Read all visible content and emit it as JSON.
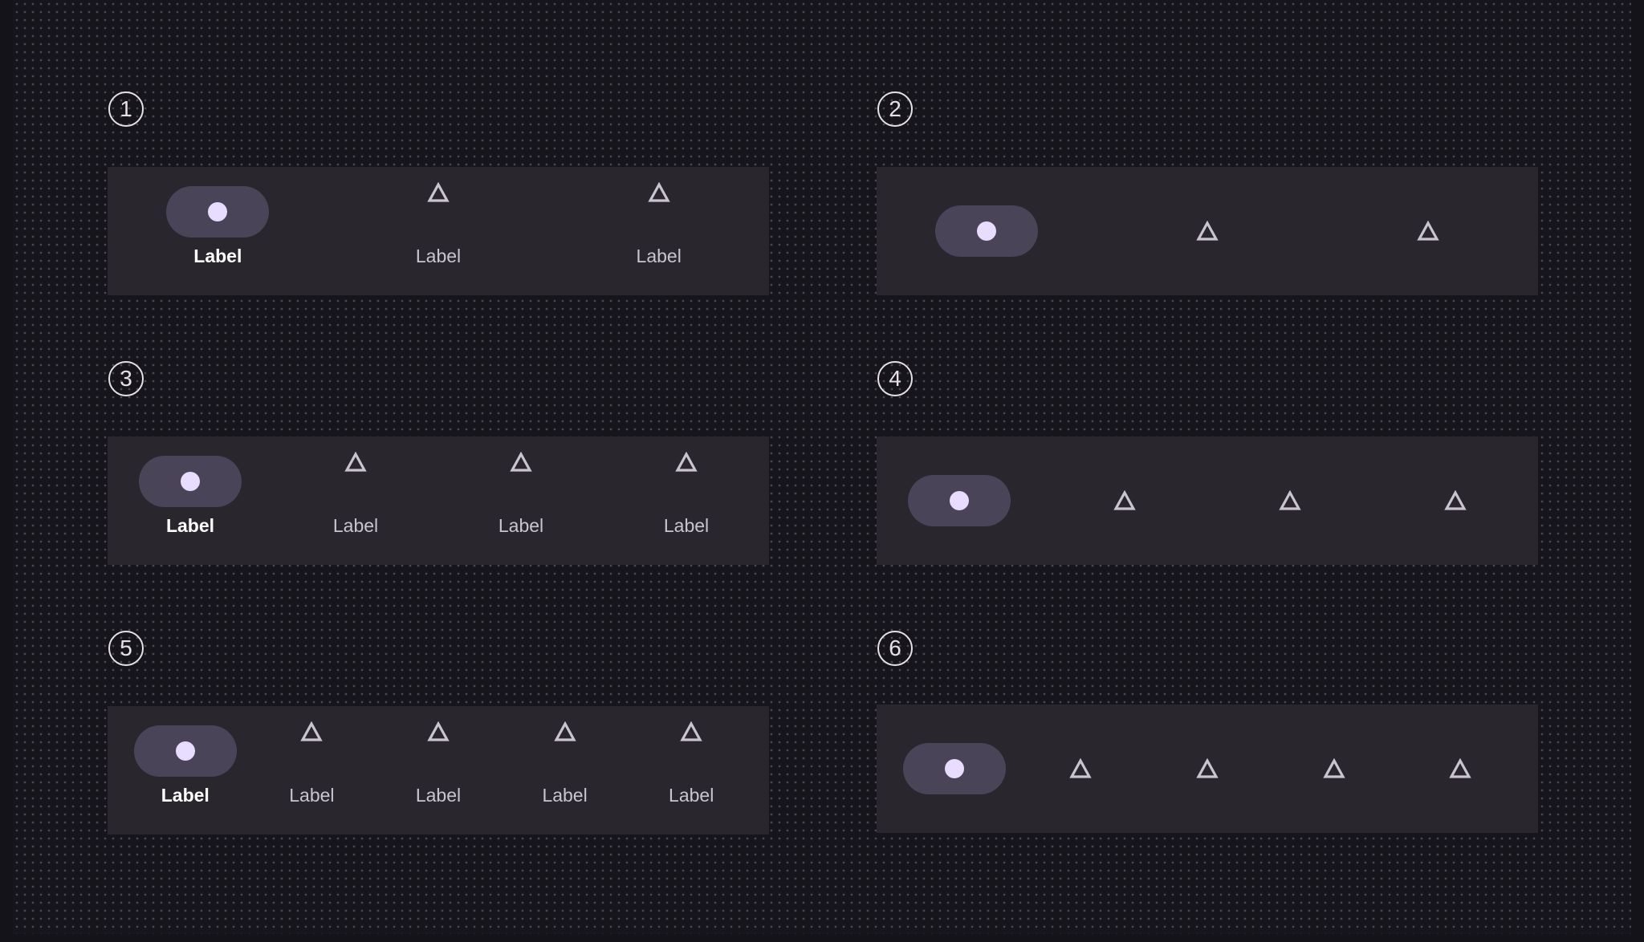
{
  "colors": {
    "background": "#15131a",
    "dot": "#4a4752",
    "bar": "#29272d",
    "indicator": "#4a4458",
    "active_dot": "#e8ddff",
    "icon": "#cac4d0",
    "badge": "#e6e1e5"
  },
  "variants": [
    {
      "number": "1",
      "items": [
        {
          "label": "Label",
          "icon": "active-dot-icon",
          "active": true
        },
        {
          "label": "Label",
          "icon": "triangle-icon",
          "active": false
        },
        {
          "label": "Label",
          "icon": "triangle-icon",
          "active": false
        }
      ]
    },
    {
      "number": "2",
      "items": [
        {
          "icon": "active-dot-icon",
          "active": true
        },
        {
          "icon": "triangle-icon",
          "active": false
        },
        {
          "icon": "triangle-icon",
          "active": false
        }
      ]
    },
    {
      "number": "3",
      "items": [
        {
          "label": "Label",
          "icon": "active-dot-icon",
          "active": true
        },
        {
          "label": "Label",
          "icon": "triangle-icon",
          "active": false
        },
        {
          "label": "Label",
          "icon": "triangle-icon",
          "active": false
        },
        {
          "label": "Label",
          "icon": "triangle-icon",
          "active": false
        }
      ]
    },
    {
      "number": "4",
      "items": [
        {
          "icon": "active-dot-icon",
          "active": true
        },
        {
          "icon": "triangle-icon",
          "active": false
        },
        {
          "icon": "triangle-icon",
          "active": false
        },
        {
          "icon": "triangle-icon",
          "active": false
        }
      ]
    },
    {
      "number": "5",
      "items": [
        {
          "label": "Label",
          "icon": "active-dot-icon",
          "active": true
        },
        {
          "label": "Label",
          "icon": "triangle-icon",
          "active": false
        },
        {
          "label": "Label",
          "icon": "triangle-icon",
          "active": false
        },
        {
          "label": "Label",
          "icon": "triangle-icon",
          "active": false
        },
        {
          "label": "Label",
          "icon": "triangle-icon",
          "active": false
        }
      ]
    },
    {
      "number": "6",
      "items": [
        {
          "icon": "active-dot-icon",
          "active": true
        },
        {
          "icon": "triangle-icon",
          "active": false
        },
        {
          "icon": "triangle-icon",
          "active": false
        },
        {
          "icon": "triangle-icon",
          "active": false
        },
        {
          "icon": "triangle-icon",
          "active": false
        }
      ]
    }
  ]
}
